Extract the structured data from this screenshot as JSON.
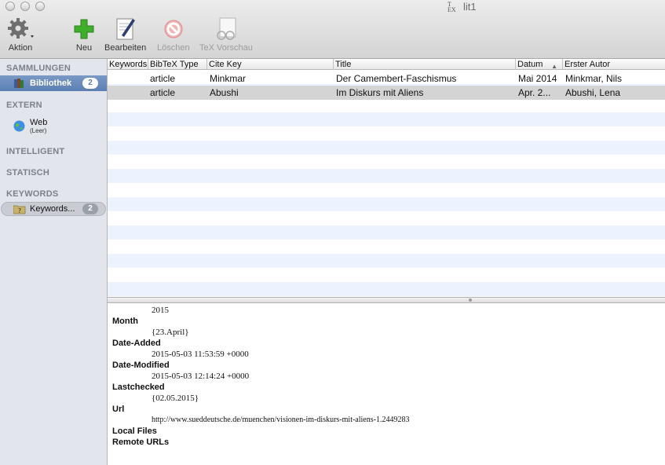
{
  "window": {
    "title": "lit1",
    "title_icon": "tex-document-icon"
  },
  "toolbar": {
    "action_label": "Aktion",
    "new_label": "Neu",
    "edit_label": "Bearbeiten",
    "delete_label": "Löschen",
    "tex_preview_label": "TeX Vorschau"
  },
  "sidebar": {
    "sammlungen": "SAMMLUNGEN",
    "library": {
      "label": "Bibliothek",
      "count": "2"
    },
    "extern": "EXTERN",
    "web": {
      "label": "Web",
      "sub": "(Leer)"
    },
    "intelligent": "INTELLIGENT",
    "statisch": "STATISCH",
    "keywords_head": "KEYWORDS",
    "keywords_item": {
      "label": "Keywords...",
      "count": "2"
    }
  },
  "table": {
    "columns": [
      "Keywords",
      "BibTeX Type",
      "Cite Key",
      "Title",
      "Datum",
      "Erster Autor"
    ],
    "rows": [
      {
        "keywords": "",
        "type": "article",
        "cite": "Minkmar",
        "title": "Der Camembert-Faschismus",
        "date": "Mai 2014",
        "author": "Minkmar, Nils"
      },
      {
        "keywords": "",
        "type": "article",
        "cite": "Abushi",
        "title": "Im Diskurs mit Aliens",
        "date": "Apr. 2...",
        "author": "Abushi, Lena"
      }
    ]
  },
  "detail": {
    "year_value": "2015",
    "month_key": "Month",
    "month_value": "{23.April}",
    "added_key": "Date-Added",
    "added_value": "2015-05-03 11:53:59 +0000",
    "modified_key": "Date-Modified",
    "modified_value": "2015-05-03 12:14:24 +0000",
    "lastchecked_key": "Lastchecked",
    "lastchecked_value": "{02.05.2015}",
    "url_key": "Url",
    "url_value": "http://www.sueddeutsche.de/muenchen/visionen-im-diskurs-mit-aliens-1.2449283",
    "local_files_key": "Local Files",
    "remote_urls_key": "Remote URLs"
  }
}
